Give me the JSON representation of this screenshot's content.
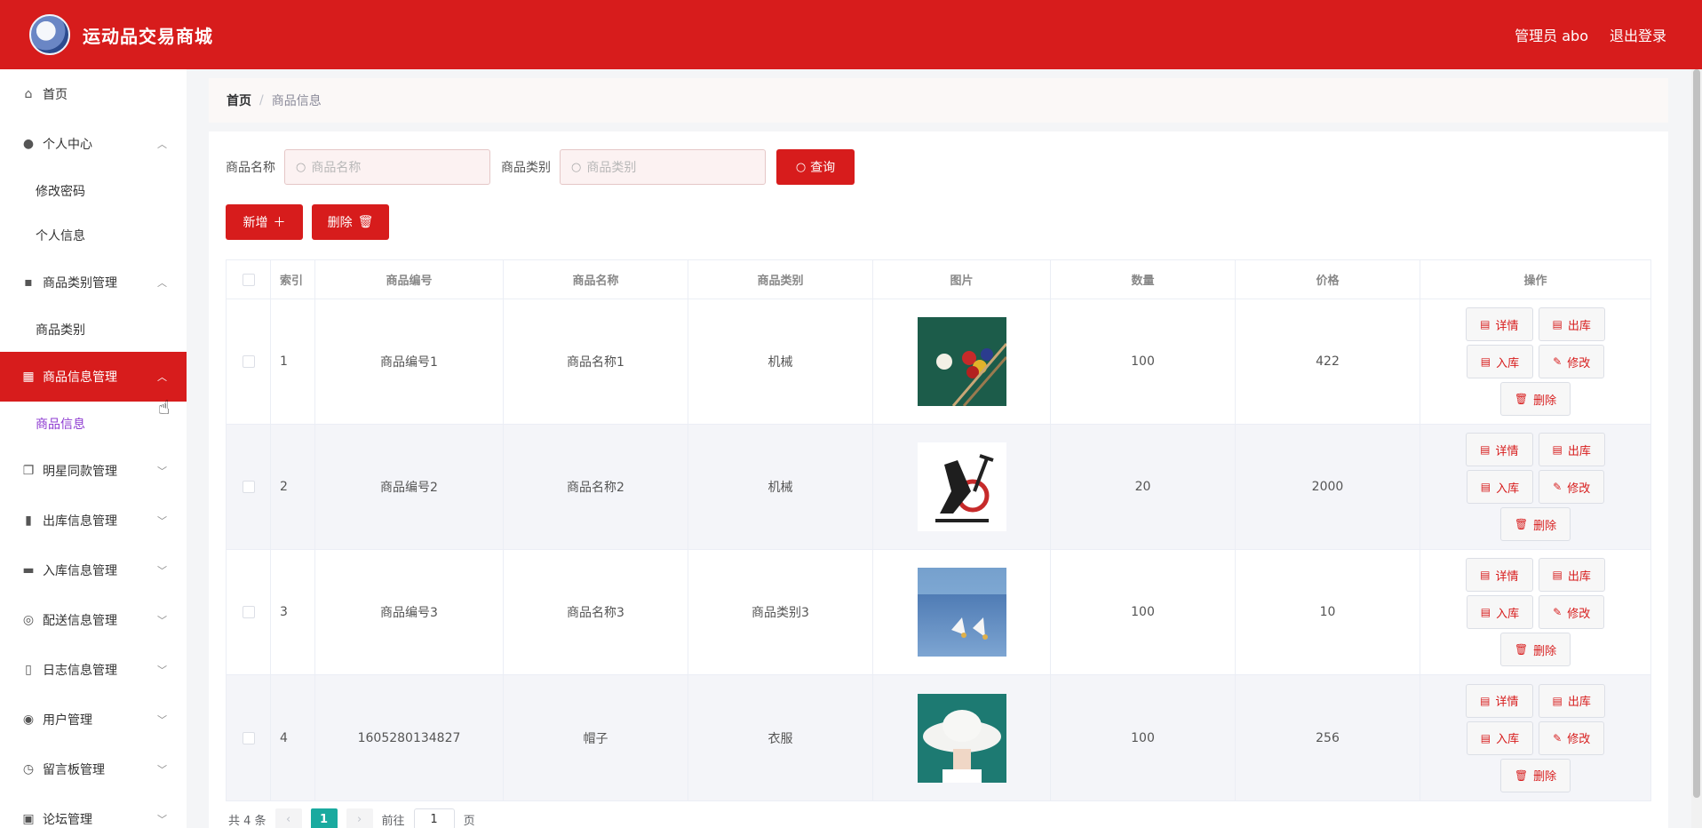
{
  "app": {
    "title": "运动品交易商城"
  },
  "header": {
    "user": "管理员 abo",
    "logout": "退出登录"
  },
  "sidebar": {
    "home": "首页",
    "personal": {
      "label": "个人中心",
      "children": [
        "修改密码",
        "个人信息"
      ]
    },
    "category_mgmt": {
      "label": "商品类别管理",
      "children": [
        "商品类别"
      ]
    },
    "goods_mgmt": {
      "label": "商品信息管理",
      "children": [
        "商品信息"
      ]
    },
    "others": [
      "明星同款管理",
      "出库信息管理",
      "入库信息管理",
      "配送信息管理",
      "日志信息管理",
      "用户管理",
      "留言板管理",
      "论坛管理"
    ]
  },
  "breadcrumb": {
    "home": "首页",
    "current": "商品信息"
  },
  "search": {
    "name_label": "商品名称",
    "name_placeholder": "商品名称",
    "category_label": "商品类别",
    "category_placeholder": "商品类别",
    "query_label": "查询"
  },
  "actions": {
    "add": "新增",
    "delete": "删除"
  },
  "table": {
    "headers": [
      "索引",
      "商品编号",
      "商品名称",
      "商品类别",
      "图片",
      "数量",
      "价格",
      "操作"
    ],
    "rows": [
      {
        "index": "1",
        "code": "商品编号1",
        "name": "商品名称1",
        "category": "机械",
        "image": "billiards-photo",
        "quantity": "100",
        "price": "422"
      },
      {
        "index": "2",
        "code": "商品编号2",
        "name": "商品名称2",
        "category": "机械",
        "image": "exercise-bike-photo",
        "quantity": "20",
        "price": "2000"
      },
      {
        "index": "3",
        "code": "商品编号3",
        "name": "商品名称3",
        "category": "商品类别3",
        "image": "badminton-photo",
        "quantity": "100",
        "price": "10"
      },
      {
        "index": "4",
        "code": "1605280134827",
        "name": "帽子",
        "category": "衣服",
        "image": "hat-photo",
        "quantity": "100",
        "price": "256"
      }
    ],
    "ops": {
      "detail": "详情",
      "out": "出库",
      "in": "入库",
      "edit": "修改",
      "delete": "删除"
    }
  },
  "pagination": {
    "total": "共 4 条",
    "current_page": "1",
    "goto_prefix": "前往",
    "goto_value": "1",
    "goto_suffix": "页"
  },
  "colors": {
    "brand": "#d71c1c",
    "selected_sub": "#8e3bd1",
    "page_active": "#1aaa9f"
  }
}
